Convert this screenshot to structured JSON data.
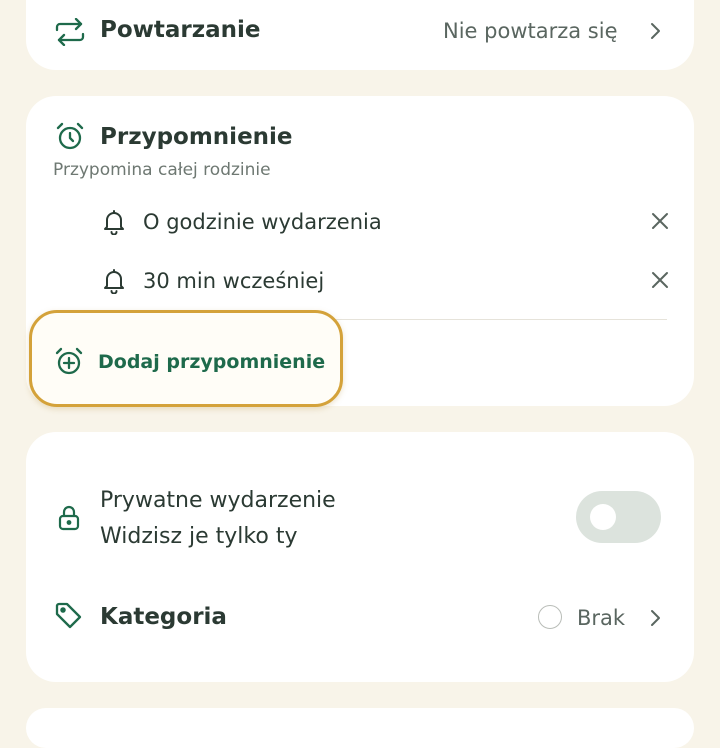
{
  "repeat": {
    "label": "Powtarzanie",
    "value": "Nie powtarza się"
  },
  "reminder": {
    "title": "Przypomnienie",
    "subtitle": "Przypomina całej rodzinie",
    "items": [
      {
        "label": "O godzinie wydarzenia"
      },
      {
        "label": "30 min wcześniej"
      }
    ],
    "add_label": "Dodaj przypomnienie"
  },
  "private_event": {
    "title": "Prywatne wydarzenie",
    "subtitle": "Widzisz je tylko ty",
    "enabled": false
  },
  "category": {
    "label": "Kategoria",
    "value": "Brak"
  },
  "colors": {
    "accent": "#1e6a4b",
    "highlight": "#d4a23a",
    "background": "#f8f4e9"
  }
}
